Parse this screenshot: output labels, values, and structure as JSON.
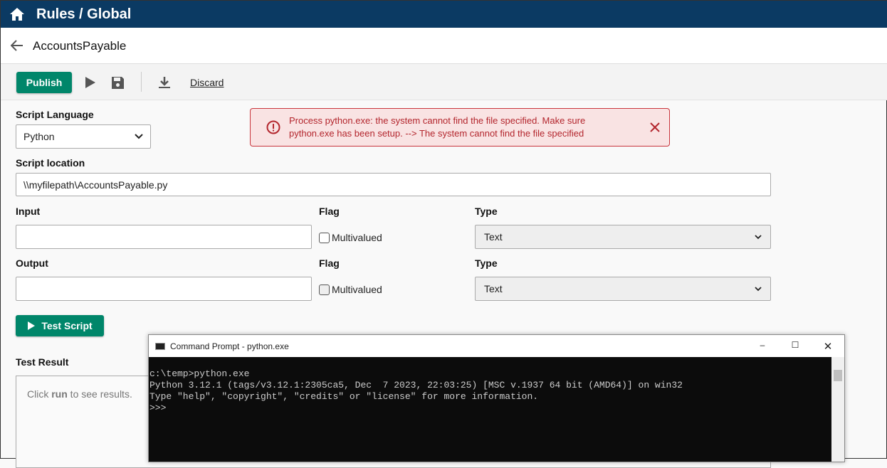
{
  "header": {
    "title": "Rules / Global"
  },
  "subheader": {
    "name": "AccountsPayable"
  },
  "toolbar": {
    "publish": "Publish",
    "discard": "Discard"
  },
  "form": {
    "script_language_label": "Script Language",
    "script_language": "Python",
    "script_location_label": "Script location",
    "script_location": "\\\\myfilepath\\AccountsPayable.py",
    "input_label": "Input",
    "input_value": "",
    "output_label": "Output",
    "output_value": "",
    "flag_label": "Flag",
    "multivalued": "Multivalued",
    "type_label": "Type",
    "input_type": "Text",
    "output_type": "Text",
    "test_button": "Test Script",
    "test_result_label": "Test Result",
    "result_pre": "Click ",
    "result_bold": "run",
    "result_post": " to see results."
  },
  "error": {
    "message": "Process python.exe: the system cannot find the file specified. Make sure python.exe has been setup. --> The system cannot find the file specified"
  },
  "cmd": {
    "title": "Command Prompt - python.exe",
    "lines": [
      "c:\\temp>python.exe",
      "Python 3.12.1 (tags/v3.12.1:2305ca5, Dec  7 2023, 22:03:25) [MSC v.1937 64 bit (AMD64)] on win32",
      "Type \"help\", \"copyright\", \"credits\" or \"license\" for more information.",
      ">>>"
    ]
  },
  "colors": {
    "header": "#0b3a63",
    "accent": "#00866a",
    "error": "#b3262d"
  }
}
